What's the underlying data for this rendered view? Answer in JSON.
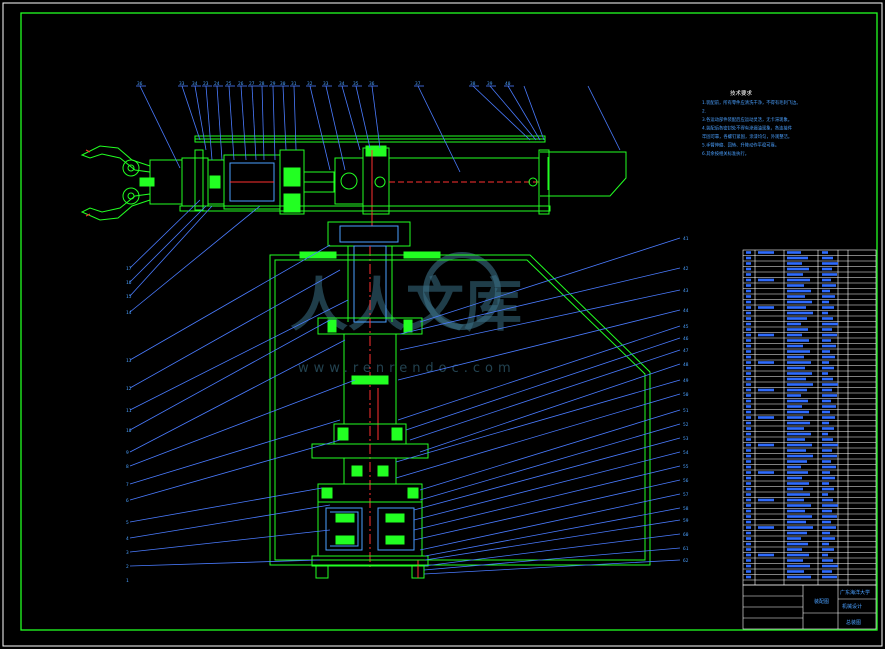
{
  "drawing": {
    "tech_requirements_title": "技术要求",
    "tech_requirements": [
      "1.装配前，所有零件应清洗干净，不得有毛刺飞边。",
      "2.",
      "3.各运动部件装配后应运动灵活，无卡滞现象。",
      "4.装配后各密封处不得有渗漏油现象，各连接件",
      "牢固可靠，各螺钉紧固，涂漆均匀，外观整洁。",
      "5.手臂伸缩、回转、升降动作平稳可靠。",
      "6.其余按相关标准执行。"
    ],
    "callouts_top": [
      "36",
      "33",
      "34",
      "23",
      "24",
      "25",
      "26",
      "27",
      "28",
      "29",
      "30",
      "31",
      "32",
      "33",
      "34",
      "35",
      "36",
      "37",
      "38",
      "39",
      "40"
    ],
    "callouts_left": [
      "17",
      "16",
      "15",
      "14",
      "13",
      "12",
      "11",
      "10",
      "9",
      "8",
      "7",
      "6",
      "5",
      "4",
      "3",
      "2",
      "1"
    ],
    "callouts_right": [
      "41",
      "42",
      "43",
      "44",
      "45",
      "46",
      "47",
      "48",
      "49",
      "50",
      "51",
      "52",
      "53",
      "54",
      "55",
      "56",
      "57",
      "58",
      "59",
      "60",
      "61",
      "62"
    ],
    "watermark": {
      "logo_text": "人人文库",
      "url_text": "www.renrendoc.com"
    },
    "title_block": {
      "title_line1": "广东海洋大学",
      "title_line2": "机械设计",
      "drawing_name": "装配图",
      "drawing_no": "总装图"
    }
  }
}
